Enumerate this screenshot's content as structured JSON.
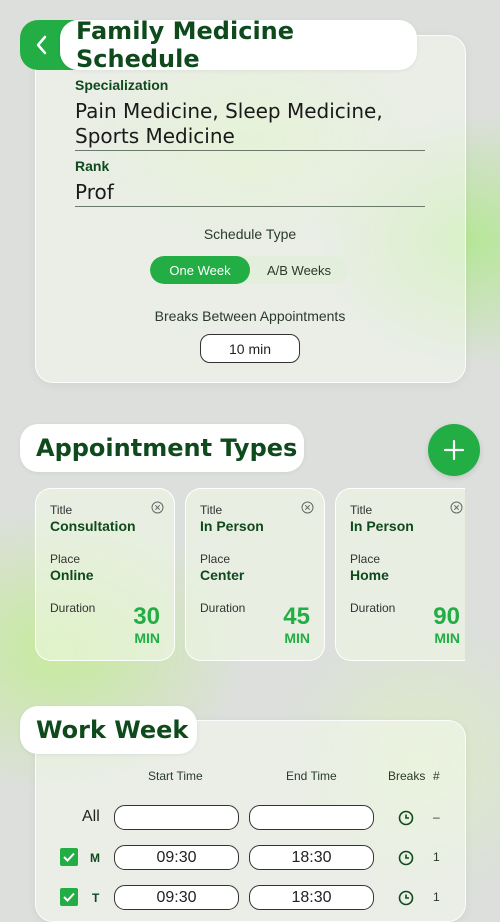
{
  "header": {
    "title": "Family Medicine Schedule"
  },
  "profile": {
    "specialization_label": "Specialization",
    "specialization_value": "Pain Medicine, Sleep Medicine, Sports Medicine",
    "rank_label": "Rank",
    "rank_value": "Prof"
  },
  "schedule": {
    "type_label": "Schedule Type",
    "options": [
      "One Week",
      "A/B Weeks"
    ],
    "selected": "One Week",
    "breaks_label": "Breaks Between Appointments",
    "breaks_value": "10 min"
  },
  "appointment_types": {
    "title": "Appointment Types",
    "field_title": "Title",
    "field_place": "Place",
    "field_duration": "Duration",
    "cards": [
      {
        "title": "Consultation",
        "place": "Online",
        "duration": "30",
        "unit": "MIN"
      },
      {
        "title": "In Person",
        "place": "Center",
        "duration": "45",
        "unit": "MIN"
      },
      {
        "title": "In Person",
        "place": "Home",
        "duration": "90",
        "unit": "MIN"
      }
    ]
  },
  "work_week": {
    "title": "Work Week",
    "headers": {
      "start": "Start Time",
      "end": "End Time",
      "breaks": "Breaks",
      "count": "#"
    },
    "rows": [
      {
        "day": "All",
        "start": "",
        "end": "",
        "count": "–",
        "checked": false
      },
      {
        "day": "M",
        "start": "09:30",
        "end": "18:30",
        "count": "1",
        "checked": true
      },
      {
        "day": "T",
        "start": "09:30",
        "end": "18:30",
        "count": "1",
        "checked": true
      }
    ]
  },
  "colors": {
    "accent": "#22ad45",
    "dark_green": "#0f4a1d"
  },
  "icons": {
    "back": "chevron-left-icon",
    "add": "plus-icon",
    "remove": "close-circle-icon",
    "breaks": "clock-icon",
    "check": "checkmark-icon"
  }
}
